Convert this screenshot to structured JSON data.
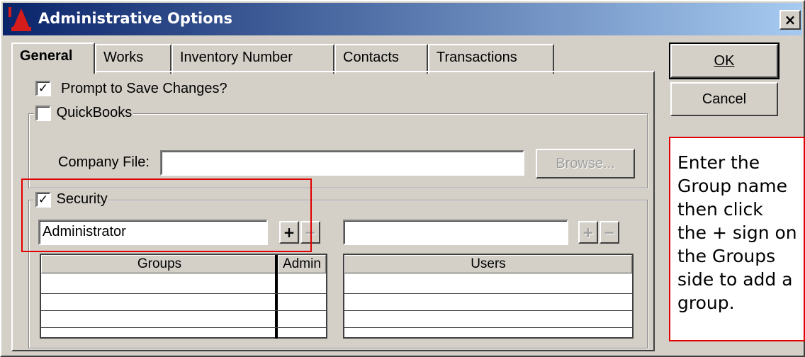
{
  "window": {
    "title": "Administrative Options",
    "close_glyph": "×",
    "icon": "app-logo-icon"
  },
  "tabs": [
    {
      "label": "General",
      "active": true
    },
    {
      "label": "Works",
      "active": false
    },
    {
      "label": "Inventory Number",
      "active": false
    },
    {
      "label": "Contacts",
      "active": false
    },
    {
      "label": "Transactions",
      "active": false
    }
  ],
  "buttons": {
    "ok_label": "OK",
    "cancel_label": "Cancel"
  },
  "general": {
    "prompt_save": {
      "label": "Prompt to Save Changes?",
      "checked": true,
      "glyph": "✓"
    },
    "quickbooks": {
      "label": "QuickBooks",
      "checked": false,
      "company_file_label": "Company File:",
      "company_file_value": "",
      "browse_label": "Browse..."
    },
    "security": {
      "label": "Security",
      "checked": true,
      "glyph": "✓",
      "group_input_value": "Administrator",
      "user_input_value": "",
      "add_label": "+",
      "remove_label": "−",
      "groups_table": {
        "headers": [
          "Groups",
          "Admin"
        ]
      },
      "users_table": {
        "headers": [
          "Users"
        ]
      }
    }
  },
  "annotation": {
    "text": "Enter the\nGroup name\nthen click\nthe + sign on\nthe Groups\nside to add a\ngroup.",
    "border_color": "#e00000"
  },
  "colors": {
    "title_start": "#0a246a",
    "title_end": "#a6caf0",
    "face": "#d4d0c8"
  }
}
